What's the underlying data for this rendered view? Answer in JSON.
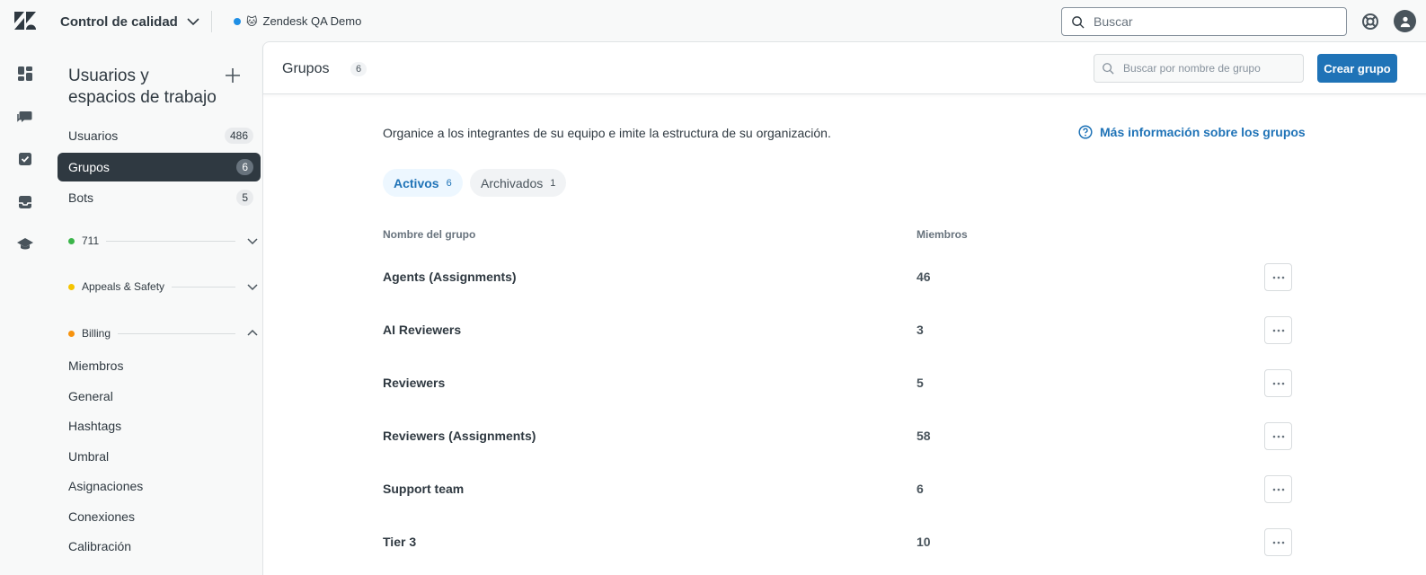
{
  "topbar": {
    "product": "Control de calidad",
    "workspace": {
      "name": "Zendesk QA Demo",
      "dot_color": "#1f8fe5",
      "emoji": "🐱"
    },
    "search_placeholder": "Buscar"
  },
  "rail": {
    "icons": [
      "dashboard-icon",
      "conversations-icon",
      "tasks-icon",
      "inbox-icon",
      "academy-icon"
    ]
  },
  "sidebar": {
    "title": "Usuarios y espacios de trabajo",
    "items": [
      {
        "label": "Usuarios",
        "count": "486",
        "active": false
      },
      {
        "label": "Grupos",
        "count": "6",
        "active": true
      },
      {
        "label": "Bots",
        "count": "5",
        "active": false
      }
    ],
    "workspaces": [
      {
        "name": "711",
        "color": "#3bb54a",
        "expanded": false
      },
      {
        "name": "Appeals & Safety",
        "color": "#f5c400",
        "expanded": false
      },
      {
        "name": "Billing",
        "color": "#f7930e",
        "expanded": true
      }
    ],
    "billing_items": [
      "Miembros",
      "General",
      "Hashtags",
      "Umbral",
      "Asignaciones",
      "Conexiones",
      "Calibración"
    ]
  },
  "main": {
    "title": "Grupos",
    "count": "6",
    "search_placeholder": "Buscar por nombre de grupo",
    "create_button": "Crear grupo",
    "description": "Organice a los integrantes de su equipo e imite la estructura de su organización.",
    "more_info": "Más información sobre los grupos",
    "tabs": [
      {
        "label": "Activos",
        "count": "6",
        "active": true
      },
      {
        "label": "Archivados",
        "count": "1",
        "active": false
      }
    ],
    "columns": {
      "name": "Nombre del grupo",
      "members": "Miembros"
    },
    "groups": [
      {
        "name": "Agents (Assignments)",
        "members": "46"
      },
      {
        "name": "AI Reviewers",
        "members": "3"
      },
      {
        "name": "Reviewers",
        "members": "5"
      },
      {
        "name": "Reviewers (Assignments)",
        "members": "58"
      },
      {
        "name": "Support team",
        "members": "6"
      },
      {
        "name": "Tier 3",
        "members": "10"
      }
    ]
  },
  "colors": {
    "accent": "#1f73b7",
    "active_nav": "#2f3941"
  }
}
